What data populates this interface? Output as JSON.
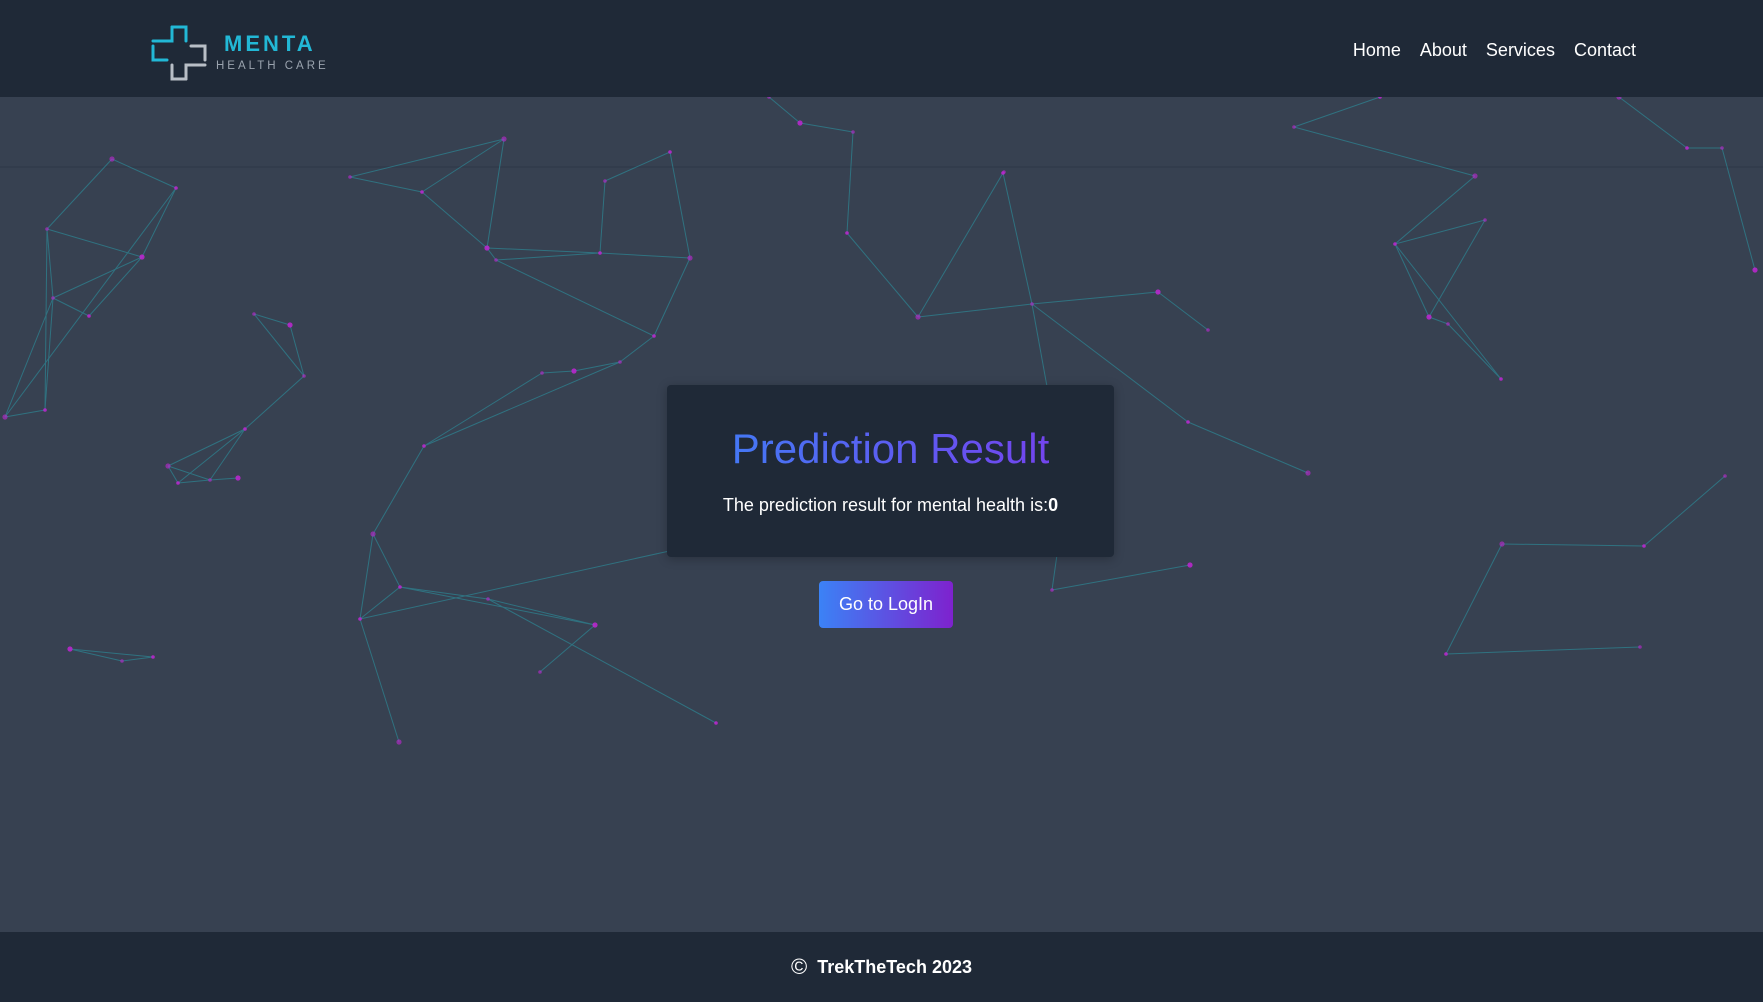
{
  "brand": {
    "name": "MENTA",
    "tagline": "HEALTH CARE"
  },
  "nav": {
    "items": [
      "Home",
      "About",
      "Services",
      "Contact"
    ]
  },
  "result": {
    "title": "Prediction Result",
    "message": "The prediction result for mental health is:",
    "value": "0"
  },
  "actions": {
    "login_label": "Go to LogIn"
  },
  "footer": {
    "copyright_symbol": "©",
    "text": "TrekTheTech 2023"
  },
  "colors": {
    "header_bg": "#1f2937",
    "page_bg": "#374151",
    "accent_teal": "#22b8d6",
    "gradient_start": "#3b82f6",
    "gradient_end": "#7c3aed",
    "network_line": "#2a9aa8",
    "network_node": "#c026d3"
  },
  "icons": {
    "logo": "medical-cross-icon",
    "copyright": "copyright-icon"
  }
}
